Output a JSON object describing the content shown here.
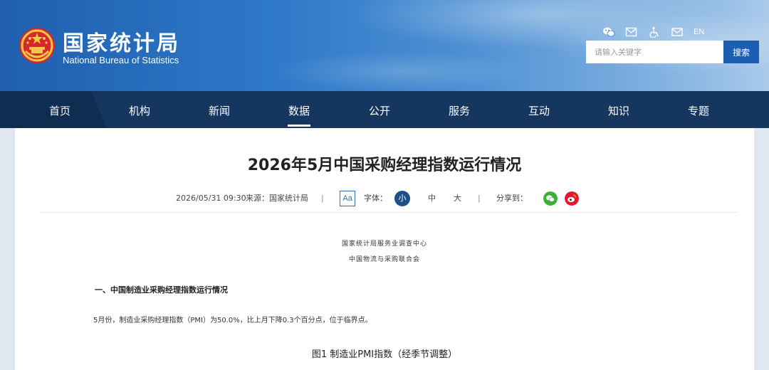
{
  "header": {
    "site_name_cn": "国家统计局",
    "site_name_en": "National Bureau of Statistics",
    "tools": {
      "wechat_icon": "wechat-icon",
      "mail_icon": "mail-icon",
      "accessibility_icon": "accessibility-icon",
      "envelope_icon": "envelope-icon",
      "language_label": "EN"
    },
    "search": {
      "placeholder": "请输入关键字",
      "button_label": "搜索"
    }
  },
  "nav": {
    "items": [
      {
        "label": "首页"
      },
      {
        "label": "机构"
      },
      {
        "label": "新闻"
      },
      {
        "label": "数据"
      },
      {
        "label": "公开"
      },
      {
        "label": "服务"
      },
      {
        "label": "互动"
      },
      {
        "label": "知识"
      },
      {
        "label": "专题"
      }
    ],
    "active": "数据"
  },
  "article": {
    "title": "2026年5月中国采购经理指数运行情况",
    "meta": {
      "datetime": "2026/05/31 09:30",
      "source": "来源：国家统计局",
      "separator": "|",
      "aa_label": "Aa",
      "font_label": "字体：",
      "font_small": "小",
      "font_medium": "中",
      "font_large": "大",
      "share_label": "分享到："
    },
    "org_lines": [
      "国家统计局服务业调查中心",
      "中国物流与采购联合会"
    ],
    "section_heading": "一、中国制造业采购经理指数运行情况",
    "paragraph": "5月份，制造业采购经理指数（PMI）为50.0%，比上月下降0.3个百分点，位于临界点。",
    "figure_title": "图1  制造业PMI指数（经季节调整）"
  },
  "colors": {
    "header_blue": "#2e78c8",
    "nav_bg": "#14365f",
    "search_button": "#1c5fb0",
    "wechat_green": "#3cb034",
    "weibo_red": "#e6162d"
  }
}
